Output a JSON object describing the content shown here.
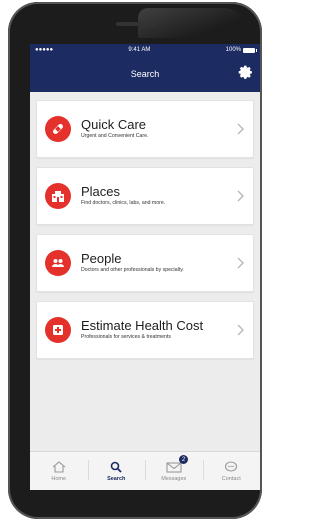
{
  "status_bar": {
    "signal": "●●●●● ",
    "time": "9:41 AM",
    "battery": "100%"
  },
  "header": {
    "title": "Search",
    "settings_icon": "gear-icon"
  },
  "cards": [
    {
      "title": "Quick Care",
      "subtitle": "Urgent and Convenient Care.",
      "icon": "bandage-icon"
    },
    {
      "title": "Places",
      "subtitle": "Find doctors, clinics, labs, and more.",
      "icon": "building-icon"
    },
    {
      "title": "People",
      "subtitle": "Doctors and other professionals by specialty.",
      "icon": "people-icon"
    },
    {
      "title": "Estimate Health Cost",
      "subtitle": "Professionals for services & treatments",
      "icon": "medical-cross-icon"
    }
  ],
  "tabs": [
    {
      "label": "Home",
      "icon": "home-icon"
    },
    {
      "label": "Search",
      "icon": "search-icon",
      "active": true
    },
    {
      "label": "Messages",
      "icon": "mail-icon",
      "badge": "2"
    },
    {
      "label": "Contact",
      "icon": "chat-icon"
    }
  ],
  "colors": {
    "header": "#1d2b63",
    "accent": "#e4312b",
    "background": "#ececec"
  }
}
